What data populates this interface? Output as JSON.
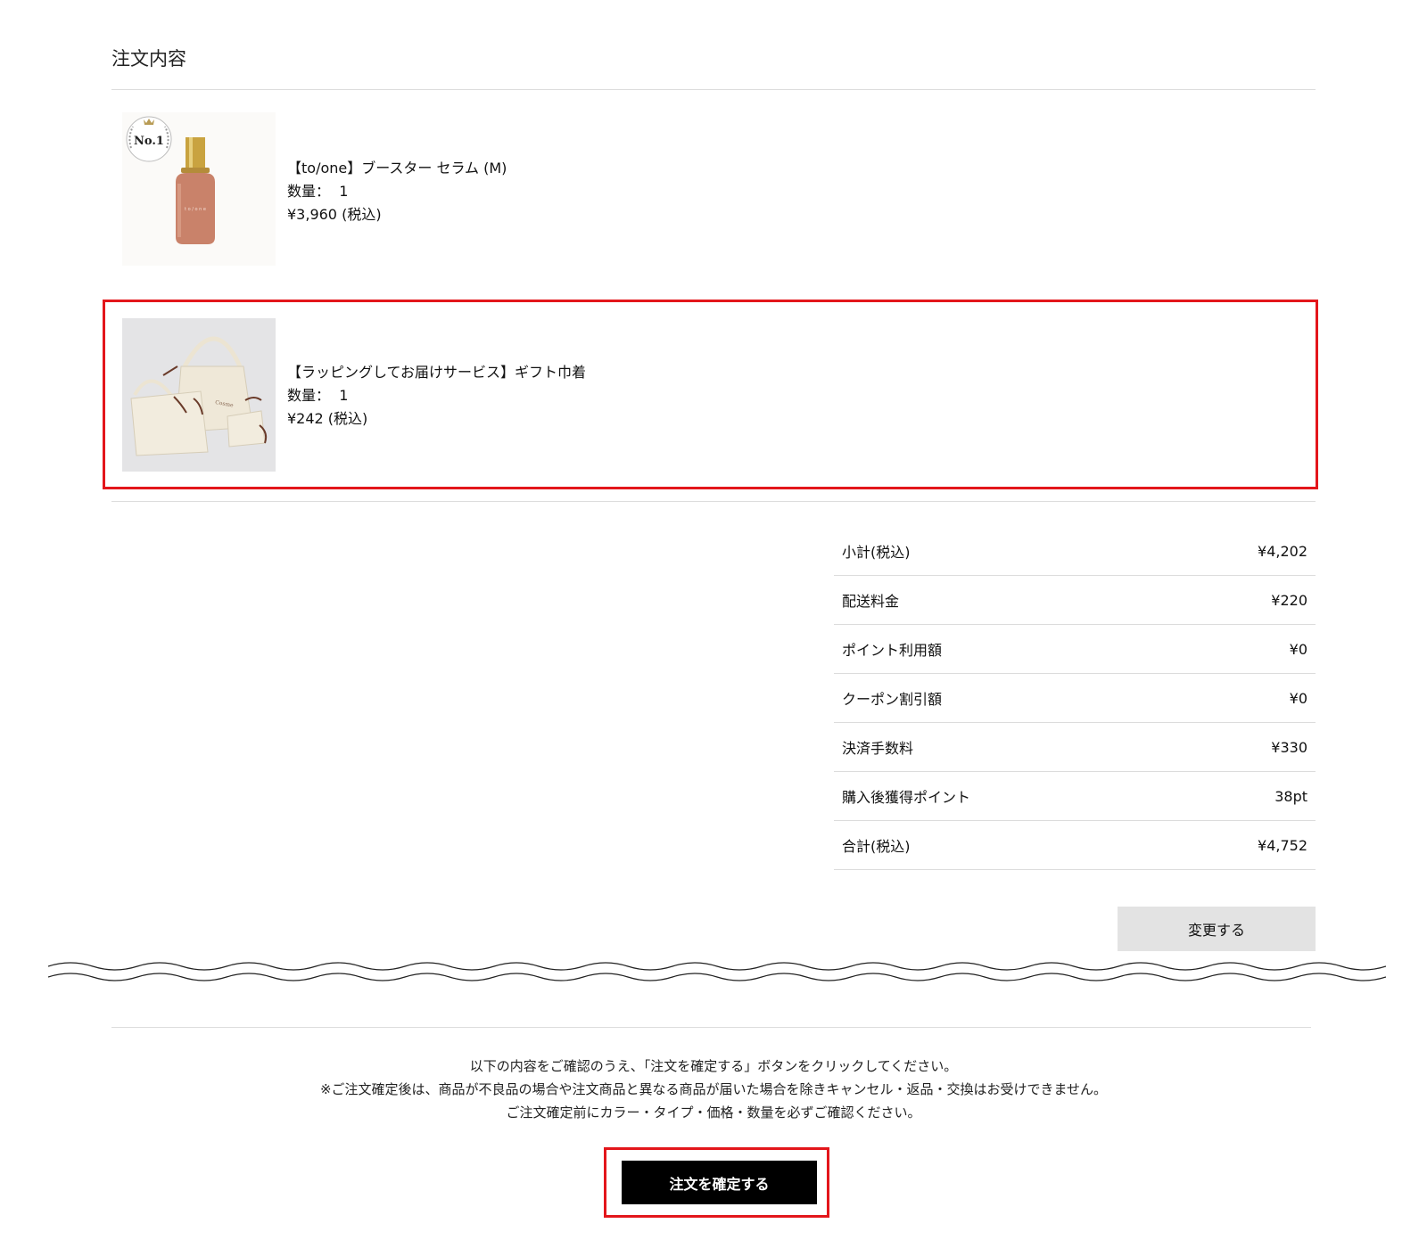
{
  "order": {
    "section_title": "注文内容",
    "items": [
      {
        "name": "【to/one】ブースター セラム (M)",
        "quantity_label": "数量：",
        "quantity": "1",
        "price": "¥3,960 (税込)",
        "image": "serum-bottle-product-image",
        "badge": "No.1"
      },
      {
        "name": "【ラッピングしてお届けサービス】ギフト巾着",
        "quantity_label": "数量：",
        "quantity": "1",
        "price": "¥242 (税込)",
        "image": "gift-pouch-product-image"
      }
    ]
  },
  "summary": {
    "rows": [
      {
        "label": "小計(税込)",
        "value": "¥4,202"
      },
      {
        "label": "配送料金",
        "value": "¥220"
      },
      {
        "label": "ポイント利用額",
        "value": "¥0"
      },
      {
        "label": "クーポン割引額",
        "value": "¥0"
      },
      {
        "label": "決済手数料",
        "value": "¥330"
      },
      {
        "label": "購入後獲得ポイント",
        "value": "38pt"
      },
      {
        "label": "合計(税込)",
        "value": "¥4,752"
      }
    ],
    "change_button": "変更する"
  },
  "confirm": {
    "notice": [
      "以下の内容をご確認のうえ、「注文を確定する」ボタンをクリックしてください。",
      "※ご注文確定後は、商品が不良品の場合や注文商品と異なる商品が届いた場合を除きキャンセル・返品・交換はお受けできません。",
      "ご注文確定前にカラー・タイプ・価格・数量を必ずご確認ください。"
    ],
    "button": "注文を確定する"
  },
  "colors": {
    "highlight": "#e3161b",
    "confirm_button_bg": "#000000",
    "change_button_bg": "#e3e3e3",
    "divider": "#dcdcdc"
  }
}
